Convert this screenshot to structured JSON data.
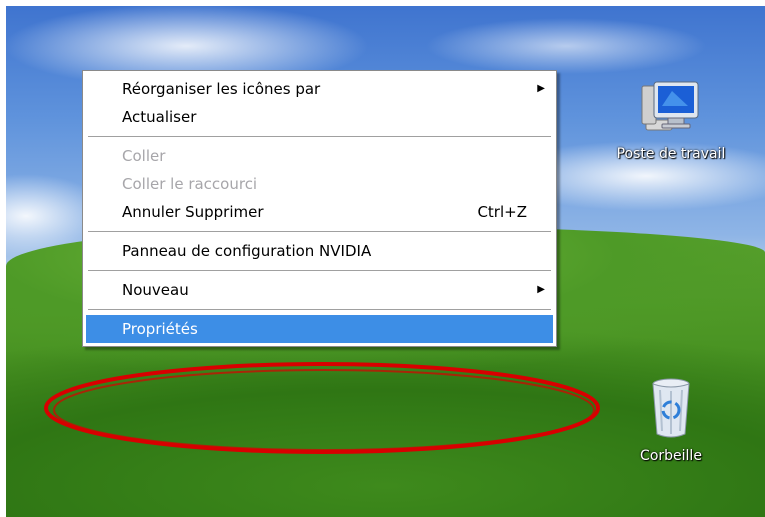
{
  "desktop": {
    "icons": [
      {
        "label": "Poste de travail",
        "icon": "my-computer-icon"
      },
      {
        "label": "Corbeille",
        "icon": "recycle-bin-icon"
      }
    ]
  },
  "context_menu": {
    "items": [
      {
        "label": "Réorganiser les icônes par",
        "has_submenu": true,
        "enabled": true
      },
      {
        "label": "Actualiser",
        "enabled": true
      },
      {
        "label": "Coller",
        "enabled": false
      },
      {
        "label": "Coller le raccourci",
        "enabled": false
      },
      {
        "label": "Annuler Supprimer",
        "shortcut": "Ctrl+Z",
        "enabled": true
      },
      {
        "label": "Panneau de configuration NVIDIA",
        "enabled": true
      },
      {
        "label": "Nouveau",
        "has_submenu": true,
        "enabled": true
      },
      {
        "label": "Propriétés",
        "enabled": true,
        "highlighted": true
      }
    ]
  },
  "colors": {
    "highlight": "#3d8ee6",
    "annotation": "#d80000",
    "disabled_text": "#a7a6aa"
  },
  "icons": {
    "submenu_arrow": "submenu-arrow-icon"
  }
}
